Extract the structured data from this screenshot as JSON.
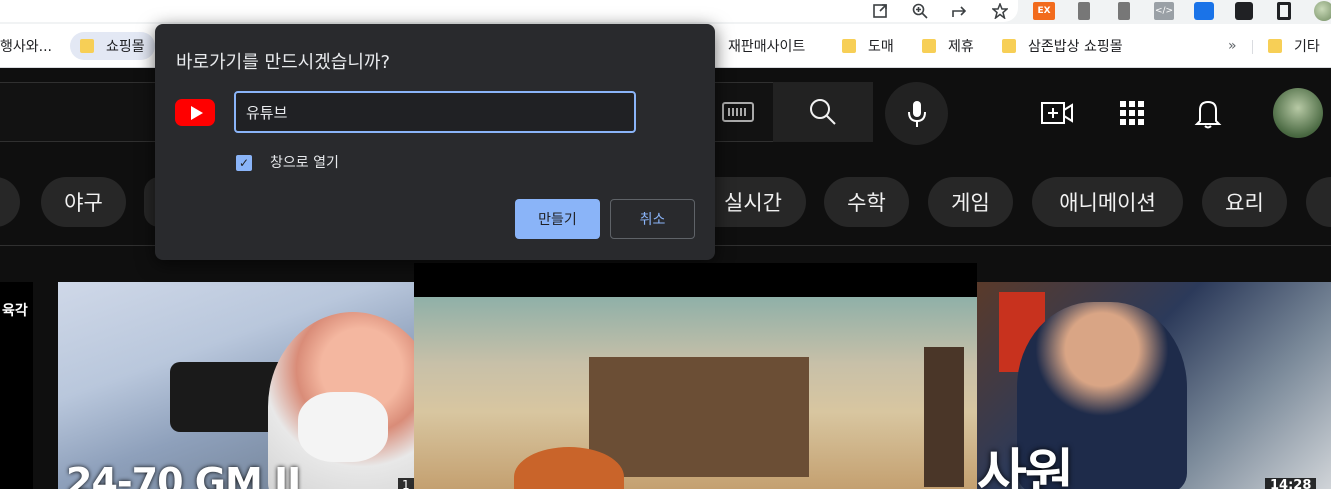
{
  "browser": {
    "toolbar_icons": [
      "share-out-icon",
      "zoom-icon",
      "share-icon",
      "star-icon"
    ],
    "extensions": [
      "ex-extension-icon",
      "extension-icon",
      "extension-icon",
      "code-extension-icon",
      "blue-extension-icon",
      "puzzle-icon",
      "side-panel-icon",
      "profile-avatar"
    ],
    "extension_ex_label": "EX"
  },
  "bookmarks": {
    "items": [
      {
        "label": "행사와..."
      },
      {
        "label": "쇼핑몰"
      },
      {
        "label": "재판매사이트"
      },
      {
        "label": "도매"
      },
      {
        "label": "제휴"
      },
      {
        "label": "삼존밥상 쇼핑몰"
      }
    ],
    "more": "»",
    "other_label": "기타"
  },
  "youtube": {
    "chips": [
      "야구",
      "실시간",
      "수학",
      "게임",
      "애니메이션",
      "요리"
    ],
    "videos": [
      {
        "partial_text": "육각"
      },
      {
        "caption": "24-70 GM II",
        "duration": "1"
      },
      {
        "caption": ""
      },
      {
        "caption": "사원",
        "duration": "14:28"
      }
    ]
  },
  "dialog": {
    "title": "바로가기를 만드시겠습니까?",
    "name_value": "유튜브",
    "checkbox_label": "창으로 열기",
    "checkbox_checked": true,
    "create_label": "만들기",
    "cancel_label": "취소",
    "accent": "#8ab4f8"
  }
}
